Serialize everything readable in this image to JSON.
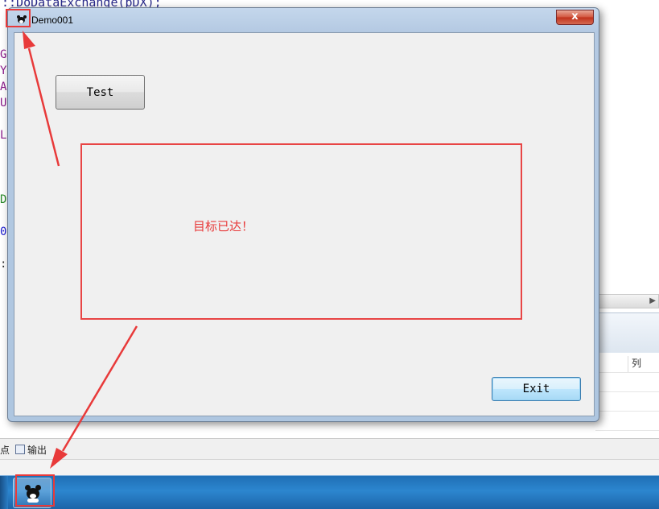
{
  "ide": {
    "code_top_line": "::DoDataExchange(pDX);",
    "margin_chars": [
      {
        "ch": "G",
        "color": "#8a1a8a"
      },
      {
        "ch": "Y",
        "color": "#8a1a8a"
      },
      {
        "ch": "A",
        "color": "#8a1a8a"
      },
      {
        "ch": "U",
        "color": "#8a1a8a"
      },
      {
        "ch": "L",
        "color": "#8a1a8a"
      },
      {
        "ch": "D",
        "color": "#2a8a2a"
      },
      {
        "ch": "0",
        "color": "#1a1ad0"
      },
      {
        "ch": ":",
        "color": "#333333"
      }
    ],
    "grid_column_header": "列",
    "tab_breakpoints_fragment": "点",
    "tab_output": "输出"
  },
  "dialog": {
    "title": "Demo001",
    "close_glyph": "x",
    "test_button_label": "Test",
    "status_text": "目标已达！",
    "exit_button_label": "Exit"
  },
  "colors": {
    "annotation_red": "#e83a3a",
    "status_text": "#e83b3b",
    "taskbar_blue": "#2c86cf"
  }
}
